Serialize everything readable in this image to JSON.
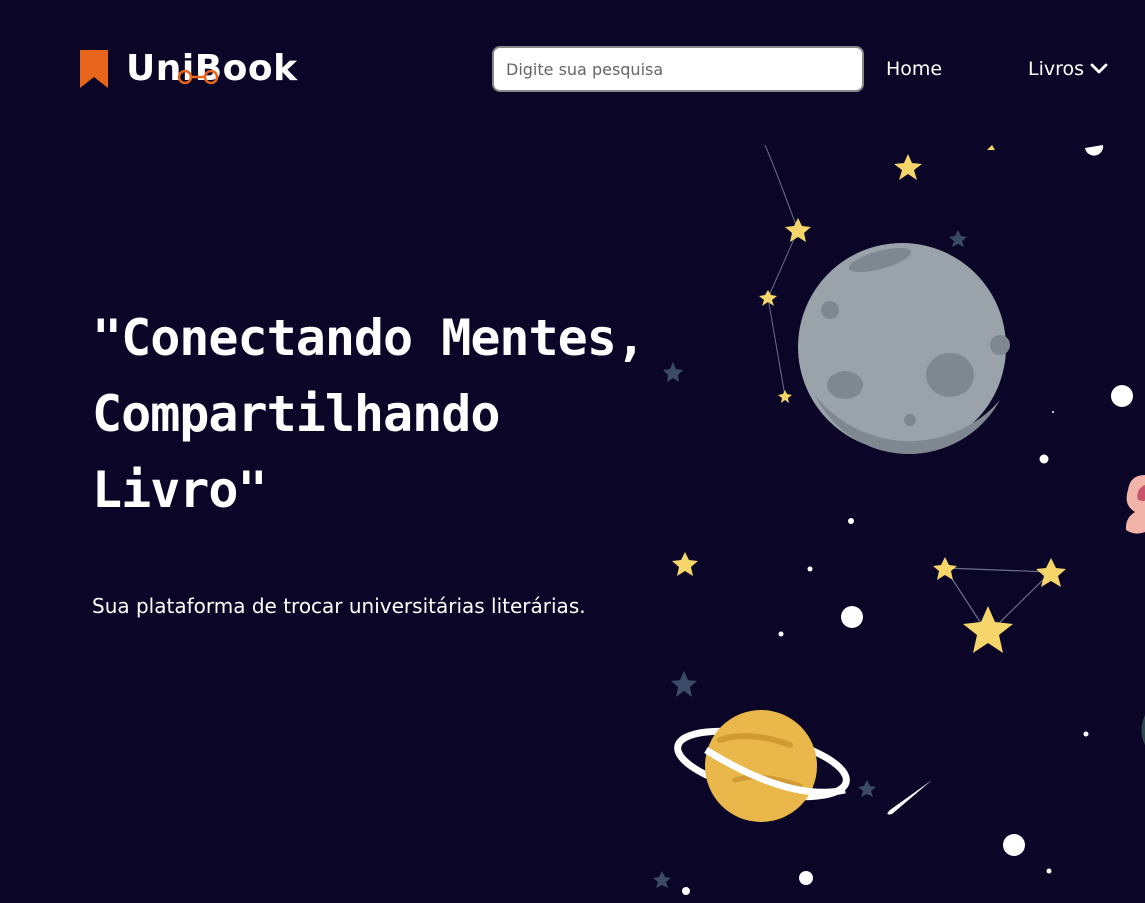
{
  "brand": {
    "name": "UniBook",
    "accent_color": "#e8651c"
  },
  "header": {
    "search_placeholder": "Digite sua pesquisa",
    "nav": {
      "home_label": "Home",
      "livros_label": "Livros"
    }
  },
  "hero": {
    "title": "\"Conectando Mentes, Compartilhando Livro\"",
    "subtitle": "Sua plataforma de trocar universitárias literárias."
  },
  "illustration": {
    "icons": [
      "bookmark-icon",
      "chevron-down-icon",
      "moon-icon",
      "planet-icon",
      "star-icon",
      "comet-icon"
    ],
    "colors": {
      "background": "#0b0628",
      "star_yellow": "#f6d56a",
      "star_dark": "#3b4a66",
      "moon_gray": "#9aa3a9",
      "planet_orange": "#e9b74a"
    }
  }
}
